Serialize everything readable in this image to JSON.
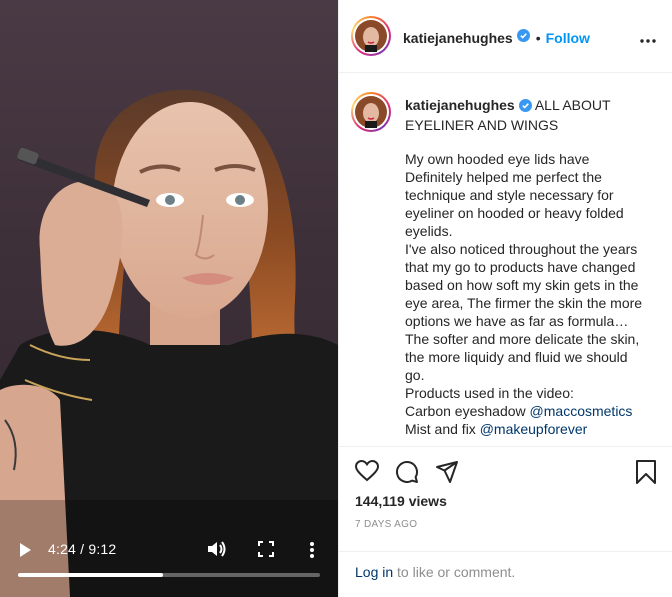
{
  "video": {
    "current_time": "4:24",
    "duration": "9:12",
    "time_separator": " / ",
    "progress_fraction": 0.48,
    "icons": [
      "play-icon",
      "volume-icon",
      "fullscreen-icon",
      "more-vertical-icon"
    ]
  },
  "header": {
    "username": "katiejanehughes",
    "separator": "•",
    "follow_label": "Follow",
    "more_icon": "more-horizontal-icon"
  },
  "caption": {
    "username": "katiejanehughes",
    "title": " ALL ABOUT EYELINER AND WINGS",
    "body": "My own hooded eye lids have Definitely helped me perfect the technique and style necessary for eyeliner on hooded or heavy folded eyelids.\nI've also noticed throughout the years that my go to products have changed based on how soft my skin gets in the eye area, The firmer the skin the more options we have as far as formula…\nThe softer and more delicate the skin, the more liquidy and fluid we should go.\nProducts used in the video:",
    "line1_prefix": "Carbon eyeshadow ",
    "line1_mention": "@maccosmetics",
    "line2_prefix": "Mist and fix ",
    "line2_mention": "@makeupforever"
  },
  "actions": {
    "icons": [
      "heart-icon",
      "comment-icon",
      "share-icon",
      "bookmark-icon"
    ],
    "views": "144,119 views",
    "posted_ago": "7 DAYS AGO"
  },
  "footer": {
    "login_label": "Log in",
    "rest_text": " to like or comment."
  },
  "colors": {
    "accent": "#0095f6",
    "verified": "#3897f0",
    "mention": "#00376b",
    "muted": "#8e8e8e",
    "border": "#efefef"
  }
}
